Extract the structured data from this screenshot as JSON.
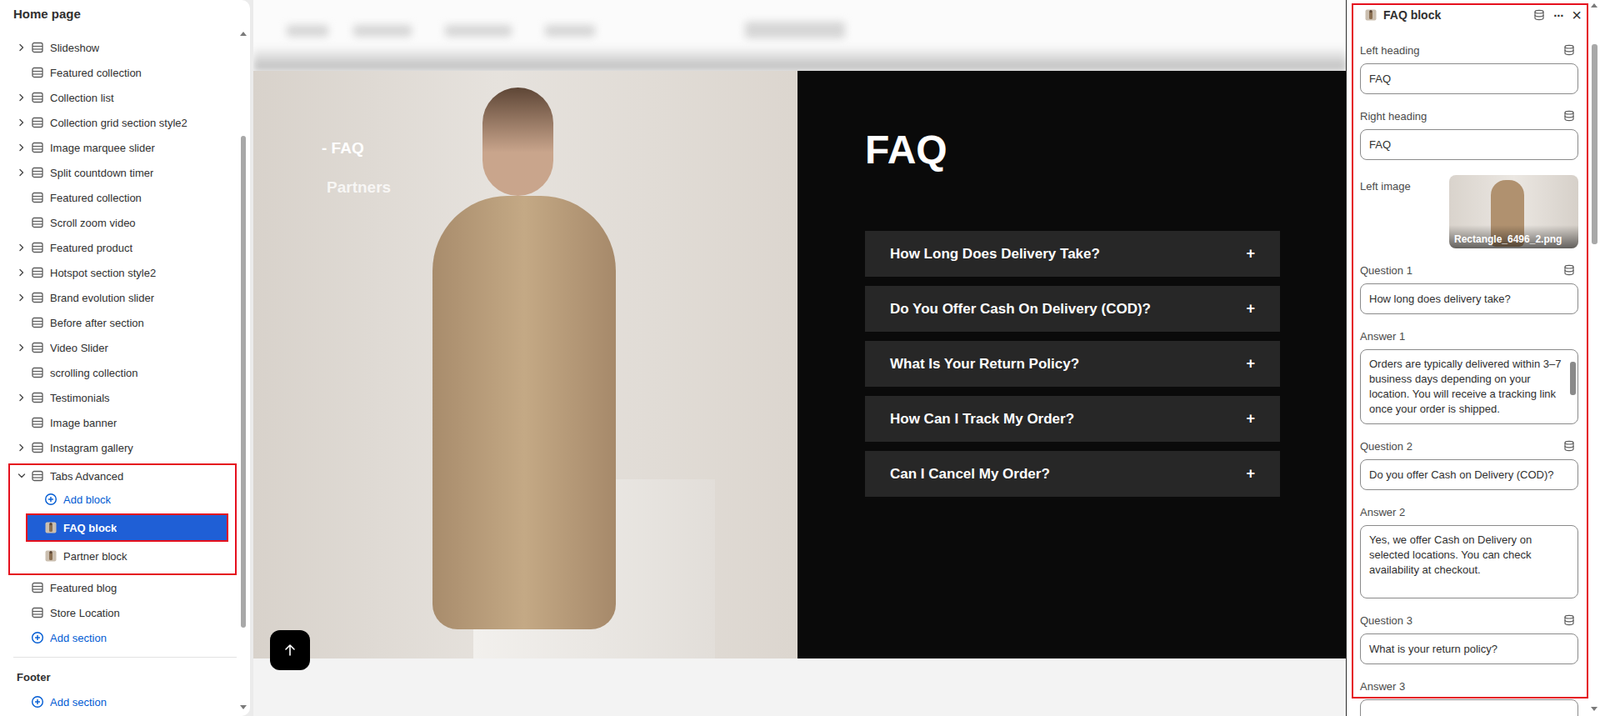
{
  "sidebar": {
    "title": "Home page",
    "sections": [
      {
        "label": "Slideshow",
        "expandable": true,
        "expanded": false
      },
      {
        "label": "Featured collection",
        "expandable": false,
        "expanded": false
      },
      {
        "label": "Collection list",
        "expandable": true,
        "expanded": false
      },
      {
        "label": "Collection grid section style2",
        "expandable": true,
        "expanded": false
      },
      {
        "label": "Image marquee slider",
        "expandable": true,
        "expanded": false
      },
      {
        "label": "Split countdown timer",
        "expandable": true,
        "expanded": false
      },
      {
        "label": "Featured collection",
        "expandable": false,
        "expanded": false
      },
      {
        "label": "Scroll zoom video",
        "expandable": false,
        "expanded": false
      },
      {
        "label": "Featured product",
        "expandable": true,
        "expanded": false
      },
      {
        "label": "Hotspot section style2",
        "expandable": true,
        "expanded": false
      },
      {
        "label": "Brand evolution slider",
        "expandable": true,
        "expanded": false
      },
      {
        "label": "Before after section",
        "expandable": false,
        "expanded": false
      },
      {
        "label": "Video Slider",
        "expandable": true,
        "expanded": false
      },
      {
        "label": "scrolling collection",
        "expandable": false,
        "expanded": false
      },
      {
        "label": "Testimonials",
        "expandable": true,
        "expanded": false
      },
      {
        "label": "Image banner",
        "expandable": false,
        "expanded": false
      },
      {
        "label": "Instagram gallery",
        "expandable": true,
        "expanded": false
      },
      {
        "label": "Tabs Advanced",
        "expandable": true,
        "expanded": true,
        "add_block": "Add block",
        "blocks": [
          {
            "label": "FAQ block",
            "selected": true
          },
          {
            "label": "Partner block",
            "selected": false
          }
        ]
      },
      {
        "label": "Featured blog",
        "expandable": false,
        "expanded": false
      },
      {
        "label": "Store Location",
        "expandable": false,
        "expanded": false
      }
    ],
    "add_section": "Add section",
    "footer": {
      "title": "Footer",
      "add_section": "Add section"
    }
  },
  "preview": {
    "tabs": [
      {
        "label": "- FAQ",
        "selected": true
      },
      {
        "label": "Partners",
        "selected": false
      }
    ],
    "heading": "FAQ",
    "faqs": [
      {
        "question": "How Long Does Delivery Take?",
        "expanded": false,
        "toggle": "+"
      },
      {
        "question": "Do You Offer Cash On Delivery (COD)?",
        "expanded": false,
        "toggle": "+"
      },
      {
        "question": "What Is Your Return Policy?",
        "expanded": false,
        "toggle": "+"
      },
      {
        "question": "How Can I Track My Order?",
        "expanded": false,
        "toggle": "+"
      },
      {
        "question": "Can I Cancel My Order?",
        "expanded": false,
        "toggle": "+"
      }
    ]
  },
  "editor": {
    "title": "FAQ block",
    "more": "···",
    "close": "×",
    "fields": [
      {
        "label": "Left heading",
        "kind": "text",
        "value": "FAQ",
        "connectable": true,
        "scrollbar": false
      },
      {
        "label": "Right heading",
        "kind": "text",
        "value": "FAQ",
        "connectable": true,
        "scrollbar": false
      },
      {
        "label": "Left image",
        "kind": "image",
        "value": "Rectangle_6496_2.png",
        "connectable": false,
        "scrollbar": false
      },
      {
        "label": "Question 1",
        "kind": "text",
        "value": "How long does delivery take?",
        "connectable": true,
        "scrollbar": false
      },
      {
        "label": "Answer 1",
        "kind": "textarea",
        "value": "Orders are typically delivered within 3–7 business days depending on your location. You will receive a tracking link once your order is shipped.",
        "connectable": false,
        "scrollbar": true
      },
      {
        "label": "Question 2",
        "kind": "text",
        "value": "Do you offer Cash on Delivery (COD)?",
        "connectable": true,
        "scrollbar": false
      },
      {
        "label": "Answer 2",
        "kind": "textarea",
        "value": "Yes, we offer Cash on Delivery on selected locations. You can check availability at checkout.",
        "connectable": false,
        "scrollbar": false
      },
      {
        "label": "Question 3",
        "kind": "text",
        "value": "What is your return policy?",
        "connectable": true,
        "scrollbar": false
      },
      {
        "label": "Answer 3",
        "kind": "textarea",
        "value": "",
        "connectable": false,
        "scrollbar": false
      }
    ]
  }
}
